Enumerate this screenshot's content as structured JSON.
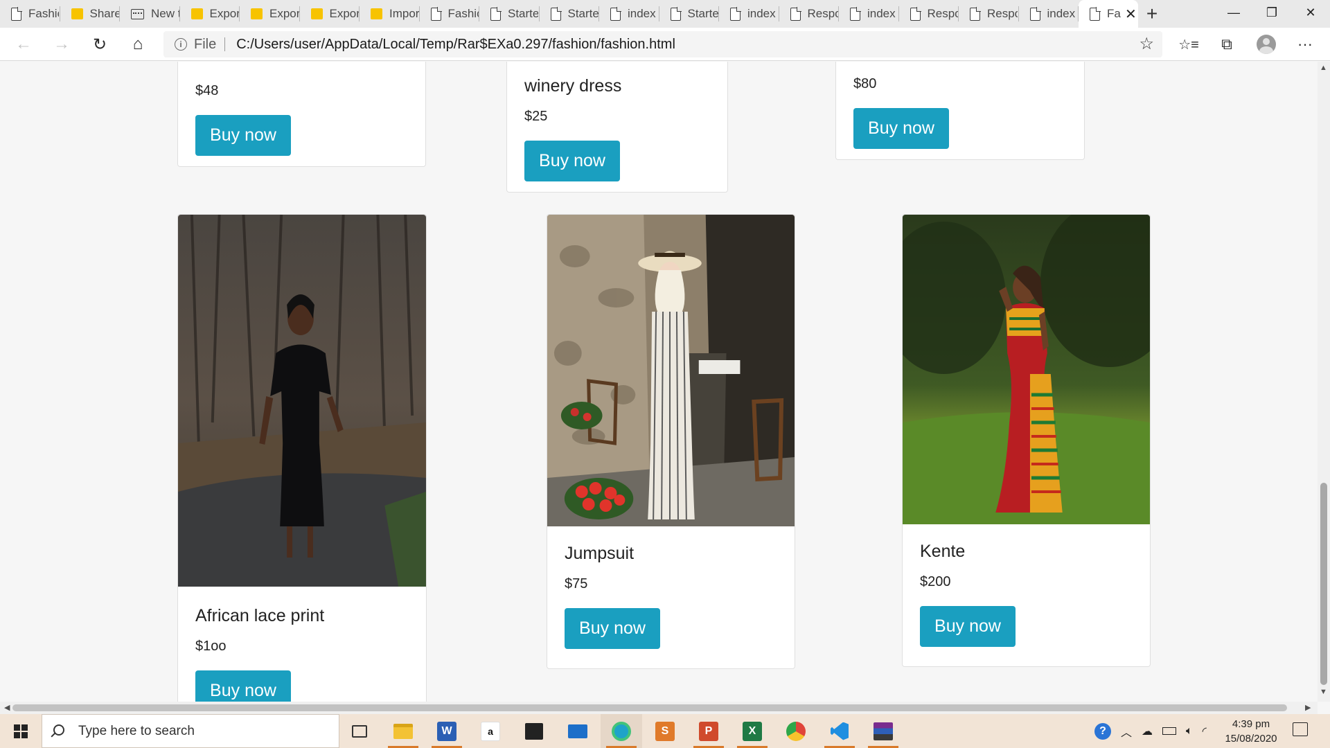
{
  "browser": {
    "tabs": [
      {
        "label": "Fashic",
        "icon": "page-icon"
      },
      {
        "label": "Share",
        "icon": "folder-icon"
      },
      {
        "label": "New t",
        "icon": "app-icon"
      },
      {
        "label": "Expor",
        "icon": "folder-icon"
      },
      {
        "label": "Expor",
        "icon": "folder-icon"
      },
      {
        "label": "Expor",
        "icon": "folder-icon"
      },
      {
        "label": "Impor",
        "icon": "folder-icon"
      },
      {
        "label": "Fashic",
        "icon": "page-icon"
      },
      {
        "label": "Starte",
        "icon": "page-icon"
      },
      {
        "label": "Starte",
        "icon": "page-icon"
      },
      {
        "label": "index",
        "icon": "page-icon"
      },
      {
        "label": "Starte",
        "icon": "page-icon"
      },
      {
        "label": "index",
        "icon": "page-icon"
      },
      {
        "label": "Respo",
        "icon": "page-icon"
      },
      {
        "label": "index",
        "icon": "page-icon"
      },
      {
        "label": "Respo",
        "icon": "page-icon"
      },
      {
        "label": "Respo",
        "icon": "page-icon"
      },
      {
        "label": "index",
        "icon": "page-icon"
      }
    ],
    "active_tab": {
      "label": "Fa",
      "close": "✕"
    },
    "new_tab": "+",
    "window_controls": {
      "minimize": "—",
      "restore": "❐",
      "close": "✕"
    },
    "address": {
      "scheme_label": "File",
      "url": "C:/Users/user/AppData/Local/Temp/Rar$EXa0.297/fashion/fashion.html"
    },
    "toolbar": {
      "back": "←",
      "forward": "→",
      "refresh": "↻",
      "home": "⌂",
      "favorite": "☆",
      "favorites": "☆≡",
      "collections": "⧉",
      "more": "···"
    }
  },
  "page": {
    "top_row": [
      {
        "title": "",
        "price": "$48",
        "button": "Buy now"
      },
      {
        "title": "winery dress",
        "price": "$25",
        "button": "Buy now"
      },
      {
        "title": "",
        "price": "$80",
        "button": "Buy now"
      }
    ],
    "products": [
      {
        "title": "African lace print",
        "price": "$1oo",
        "button": "Buy now",
        "image": "woman-black-lace-dress-photo"
      },
      {
        "title": "Jumpsuit",
        "price": "$75",
        "button": "Buy now",
        "image": "woman-striped-jumpsuit-photo"
      },
      {
        "title": "Kente",
        "price": "$200",
        "button": "Buy now",
        "image": "woman-kente-gown-photo"
      }
    ],
    "colors": {
      "button": "#1a9fc0",
      "background": "#f6f6f6",
      "card": "#ffffff"
    }
  },
  "taskbar": {
    "search_placeholder": "Type here to search",
    "apps": [
      "task-view",
      "file-explorer",
      "word",
      "amazon",
      "store",
      "mail",
      "edge",
      "sublime",
      "powerpoint",
      "excel",
      "chrome",
      "vscode",
      "winrar"
    ],
    "amazon_letter": "a",
    "sublime_letter": "S",
    "powerpoint_letter": "P",
    "excel_letter": "X",
    "word_letter": "W",
    "clock_time": "4:39 pm",
    "clock_date": "15/08/2020"
  }
}
